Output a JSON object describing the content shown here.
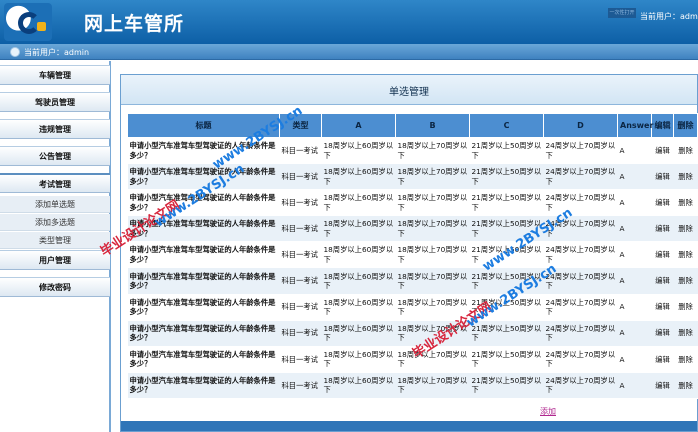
{
  "header": {
    "site_title": "网上车管所",
    "top_tab": "一次性打开",
    "current_user_label": "当前用户：admin"
  },
  "subbar": {
    "current_user_label": "当前用户：admin"
  },
  "sidebar": {
    "items": [
      {
        "label": "车辆管理"
      },
      {
        "label": "驾驶员管理"
      },
      {
        "label": "违规管理"
      },
      {
        "label": "公告管理"
      },
      {
        "label": "考试管理"
      }
    ],
    "subitems": [
      {
        "label": "添加单选题"
      },
      {
        "label": "添加多选题"
      },
      {
        "label": "类型管理"
      }
    ],
    "items_after": [
      {
        "label": "用户管理"
      },
      {
        "label": "修改密码"
      }
    ]
  },
  "main": {
    "panel_title": "单选管理",
    "columns": [
      "标题",
      "类型",
      "A",
      "B",
      "C",
      "D",
      "Answer",
      "编辑",
      "删除"
    ],
    "rows": [
      {
        "title": "申请小型汽车准驾车型驾驶证的人年龄条件是多少？",
        "type": "科目一考试",
        "a": "18周岁以上60周岁以下",
        "b": "18周岁以上70周岁以下",
        "c": "21周岁以上50周岁以下",
        "d": "24周岁以上70周岁以下",
        "answer": "A",
        "edit": "编辑",
        "delete": "删除"
      },
      {
        "title": "申请小型汽车准驾车型驾驶证的人年龄条件是多少？",
        "type": "科目一考试",
        "a": "18周岁以上60周岁以下",
        "b": "18周岁以上70周岁以下",
        "c": "21周岁以上50周岁以下",
        "d": "24周岁以上70周岁以下",
        "answer": "A",
        "edit": "编辑",
        "delete": "删除"
      },
      {
        "title": "申请小型汽车准驾车型驾驶证的人年龄条件是多少？",
        "type": "科目一考试",
        "a": "18周岁以上60周岁以下",
        "b": "18周岁以上70周岁以下",
        "c": "21周岁以上50周岁以下",
        "d": "24周岁以上70周岁以下",
        "answer": "A",
        "edit": "编辑",
        "delete": "删除"
      },
      {
        "title": "申请小型汽车准驾车型驾驶证的人年龄条件是多少？",
        "type": "科目一考试",
        "a": "18周岁以上60周岁以下",
        "b": "18周岁以上70周岁以下",
        "c": "21周岁以上50周岁以下",
        "d": "24周岁以上70周岁以下",
        "answer": "A",
        "edit": "编辑",
        "delete": "删除"
      },
      {
        "title": "申请小型汽车准驾车型驾驶证的人年龄条件是多少？",
        "type": "科目一考试",
        "a": "18周岁以上60周岁以下",
        "b": "18周岁以上70周岁以下",
        "c": "21周岁以上50周岁以下",
        "d": "24周岁以上70周岁以下",
        "answer": "A",
        "edit": "编辑",
        "delete": "删除"
      },
      {
        "title": "申请小型汽车准驾车型驾驶证的人年龄条件是多少？",
        "type": "科目一考试",
        "a": "18周岁以上60周岁以下",
        "b": "18周岁以上70周岁以下",
        "c": "21周岁以上50周岁以下",
        "d": "24周岁以上70周岁以下",
        "answer": "A",
        "edit": "编辑",
        "delete": "删除"
      },
      {
        "title": "申请小型汽车准驾车型驾驶证的人年龄条件是多少？",
        "type": "科目一考试",
        "a": "18周岁以上60周岁以下",
        "b": "18周岁以上70周岁以下",
        "c": "21周岁以上50周岁以下",
        "d": "24周岁以上70周岁以下",
        "answer": "A",
        "edit": "编辑",
        "delete": "删除"
      },
      {
        "title": "申请小型汽车准驾车型驾驶证的人年龄条件是多少？",
        "type": "科目一考试",
        "a": "18周岁以上60周岁以下",
        "b": "18周岁以上70周岁以下",
        "c": "21周岁以上50周岁以下",
        "d": "24周岁以上70周岁以下",
        "answer": "A",
        "edit": "编辑",
        "delete": "删除"
      },
      {
        "title": "申请小型汽车准驾车型驾驶证的人年龄条件是多少？",
        "type": "科目一考试",
        "a": "18周岁以上60周岁以下",
        "b": "18周岁以上70周岁以下",
        "c": "21周岁以上50周岁以下",
        "d": "24周岁以上70周岁以下",
        "answer": "A",
        "edit": "编辑",
        "delete": "删除"
      },
      {
        "title": "申请小型汽车准驾车型驾驶证的人年龄条件是多少？",
        "type": "科目一考试",
        "a": "18周岁以上60周岁以下",
        "b": "18周岁以上70周岁以下",
        "c": "21周岁以上50周岁以下",
        "d": "24周岁以上70周岁以下",
        "answer": "A",
        "edit": "编辑",
        "delete": "删除"
      }
    ],
    "add_link": "添加"
  },
  "watermarks": {
    "text_cn": "毕业设计论文网",
    "text_url": "www.2BYSJ.cn"
  }
}
